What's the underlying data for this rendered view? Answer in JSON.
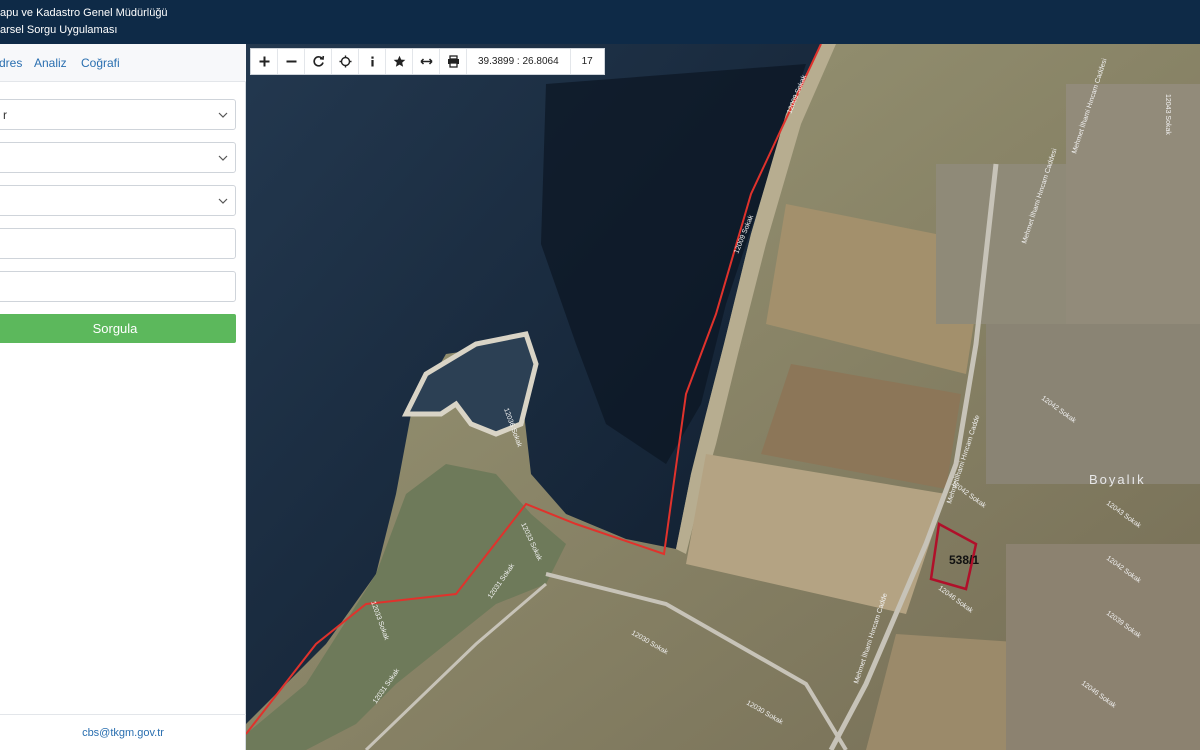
{
  "header": {
    "title_line1": "apu ve Kadastro Genel Müdürlüğü",
    "title_line2": "arsel Sorgu Uygulaması"
  },
  "sidebar": {
    "tabs": [
      {
        "label": "dres"
      },
      {
        "label": "Analiz"
      },
      {
        "label": "Coğrafi"
      }
    ],
    "fields": [
      {
        "value": "r",
        "kind": "select"
      },
      {
        "value": "",
        "kind": "select"
      },
      {
        "value": "",
        "kind": "select"
      },
      {
        "value": "",
        "kind": "input"
      },
      {
        "value": "",
        "kind": "input"
      }
    ],
    "query_button": "Sorgula",
    "footer_email": "cbs@tkgm.gov.tr"
  },
  "toolbar": {
    "coordinates": "39.3899 : 26.8064",
    "zoom_level": "17",
    "icons": [
      "zoom-in-icon",
      "zoom-out-icon",
      "refresh-icon",
      "locate-icon",
      "info-icon",
      "favorite-icon",
      "measure-icon",
      "print-icon"
    ]
  },
  "map": {
    "parcel_label": "538/1",
    "place_label": "Boyalık",
    "street_labels": [
      "12009 Sokak",
      "12009 Sokak",
      "12043 Sokak",
      "12042 Sokak",
      "12043 Sokak",
      "12042 Sokak",
      "12042 Sokak",
      "12046 Sokak",
      "12039 Sokak",
      "12046 Sokak",
      "12030 Sokak",
      "12030 Sokak",
      "12031 Sokak",
      "12031 Sokak",
      "12033 Sokak",
      "12033 Sokak",
      "12036 Sokak",
      "Mehmet İlhami Hıncam Caddesi",
      "Mehmet İlhami Hıncam Caddesi",
      "Mehmetİlhami Hıncam Cadde",
      "Mehmet İlhami Hıncam Cadde"
    ],
    "colors": {
      "sea": "#14263a",
      "land": "#8a8a6c",
      "boundary": "#e0322c",
      "parcel": "#b0102a"
    }
  }
}
